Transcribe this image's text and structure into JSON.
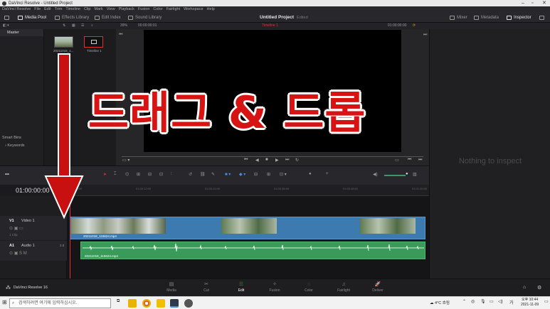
{
  "window": {
    "title": "DaVinci Resolve - Untitled Project"
  },
  "menu": [
    "DaVinci Resolve",
    "File",
    "Edit",
    "Trim",
    "Timeline",
    "Clip",
    "Mark",
    "View",
    "Playback",
    "Fusion",
    "Color",
    "Fairlight",
    "Workspace",
    "Help"
  ],
  "toolbar": {
    "media_pool": "Media Pool",
    "effects_library": "Effects Library",
    "edit_index": "Edit Index",
    "sound_library": "Sound Library",
    "project_title": "Untitled Project",
    "project_state": "Edited",
    "mixer": "Mixer",
    "metadata": "Metadata",
    "inspector": "Inspector"
  },
  "subbar": {
    "zoom": "39%",
    "source_timecode": "00:00:00:01",
    "timeline_name": "Timeline 1",
    "viewer_timecode": "01:00:00:00"
  },
  "media_pool": {
    "master_label": "Master",
    "clips": [
      {
        "label": "20211018_1..."
      },
      {
        "label": "Timeline 1"
      }
    ],
    "smart_bins_label": "Smart Bins",
    "keywords_label": "Keywords"
  },
  "inspector": {
    "empty_text": "Nothing to inspect"
  },
  "timeline": {
    "timecode": "01:00:00:00",
    "ruler_ticks": [
      "01:00:00:00",
      "01:00:12:00",
      "01:00:24:00",
      "01:00:36:00",
      "01:00:48:00",
      "01:01:00:00"
    ],
    "tracks": [
      {
        "id": "V1",
        "name": "Video 1",
        "clip_count": "1 Clip"
      },
      {
        "id": "A1",
        "name": "Audio 1",
        "channels": "2.0"
      }
    ],
    "video_clip_label": "20211018_115624.mp4",
    "audio_clip_label": "20211018_115624.mp4"
  },
  "pages": [
    {
      "label": "Media",
      "glyph": "▤"
    },
    {
      "label": "Cut",
      "glyph": "✂"
    },
    {
      "label": "Edit",
      "glyph": "☰"
    },
    {
      "label": "Fusion",
      "glyph": "✧"
    },
    {
      "label": "Color",
      "glyph": "◌"
    },
    {
      "label": "Fairlight",
      "glyph": "♫"
    },
    {
      "label": "Deliver",
      "glyph": "🚀"
    }
  ],
  "brand": "DaVinci Resolve 16",
  "taskbar": {
    "search_placeholder": "검색하려면 여기에 입력하십시오.",
    "weather": "4°C 흐림",
    "time": "오후 10:44",
    "date": "2021-11-09"
  },
  "overlay_text": "드래그 & 드롭",
  "colors": {
    "overlay_red": "#d71414",
    "video_clip": "#3d7ab0",
    "audio_clip": "#3a9a5a",
    "playhead": "#e03131"
  }
}
